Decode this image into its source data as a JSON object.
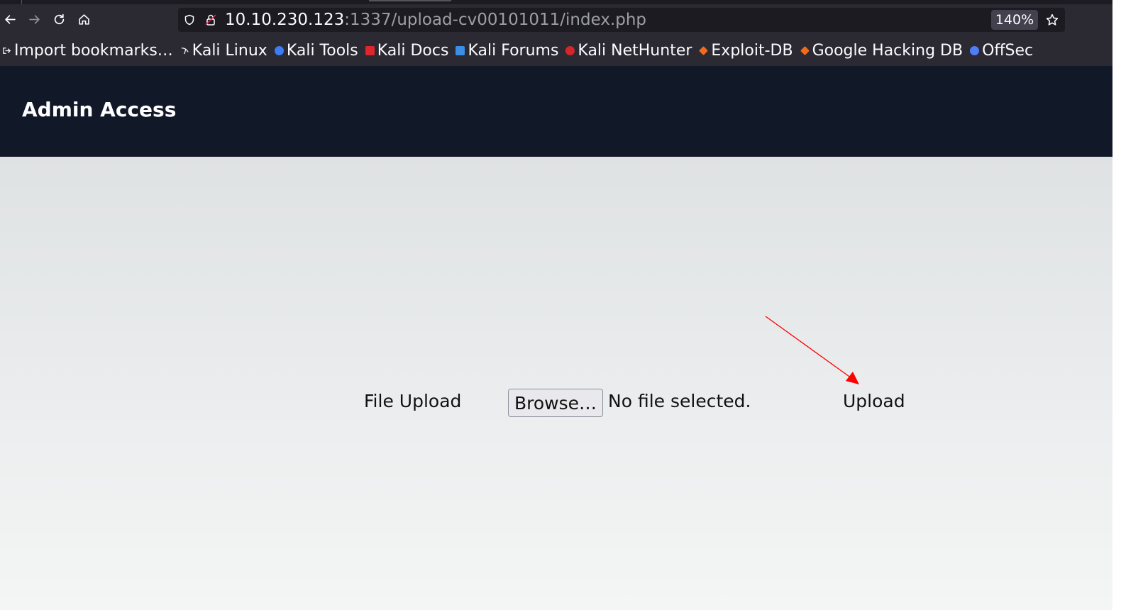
{
  "browser": {
    "url_host": "10.10.230.123",
    "url_path": ":1337/upload-cv00101011/index.php",
    "zoom": "140%",
    "nav_icons": [
      "back-arrow-icon",
      "forward-arrow-icon",
      "reload-icon",
      "home-icon"
    ],
    "bookmarks": [
      {
        "label": "Import bookmarks…",
        "icon": "import-icon",
        "color": "#fbfbfe"
      },
      {
        "label": "Kali Linux",
        "icon": "kali-dragon-icon",
        "color": "#ffffff"
      },
      {
        "label": "Kali Tools",
        "icon": "kali-tools-icon",
        "color": "#3d7cf5"
      },
      {
        "label": "Kali Docs",
        "icon": "kali-docs-icon",
        "color": "#e0252b"
      },
      {
        "label": "Kali Forums",
        "icon": "kali-forums-icon",
        "color": "#3a8ee6"
      },
      {
        "label": "Kali NetHunter",
        "icon": "kali-nethunter-icon",
        "color": "#d7262b"
      },
      {
        "label": "Exploit-DB",
        "icon": "exploit-db-icon",
        "color": "#f26a1b"
      },
      {
        "label": "Google Hacking DB",
        "icon": "ghdb-icon",
        "color": "#f26a1b"
      },
      {
        "label": "OffSec",
        "icon": "offsec-icon",
        "color": "#4d7ef7"
      }
    ]
  },
  "page": {
    "header_title": "Admin Access",
    "file_upload_label": "File Upload",
    "browse_label": "Browse…",
    "file_status": "No file selected.",
    "upload_label": "Upload",
    "annotation_arrow_color": "#ff0000"
  }
}
